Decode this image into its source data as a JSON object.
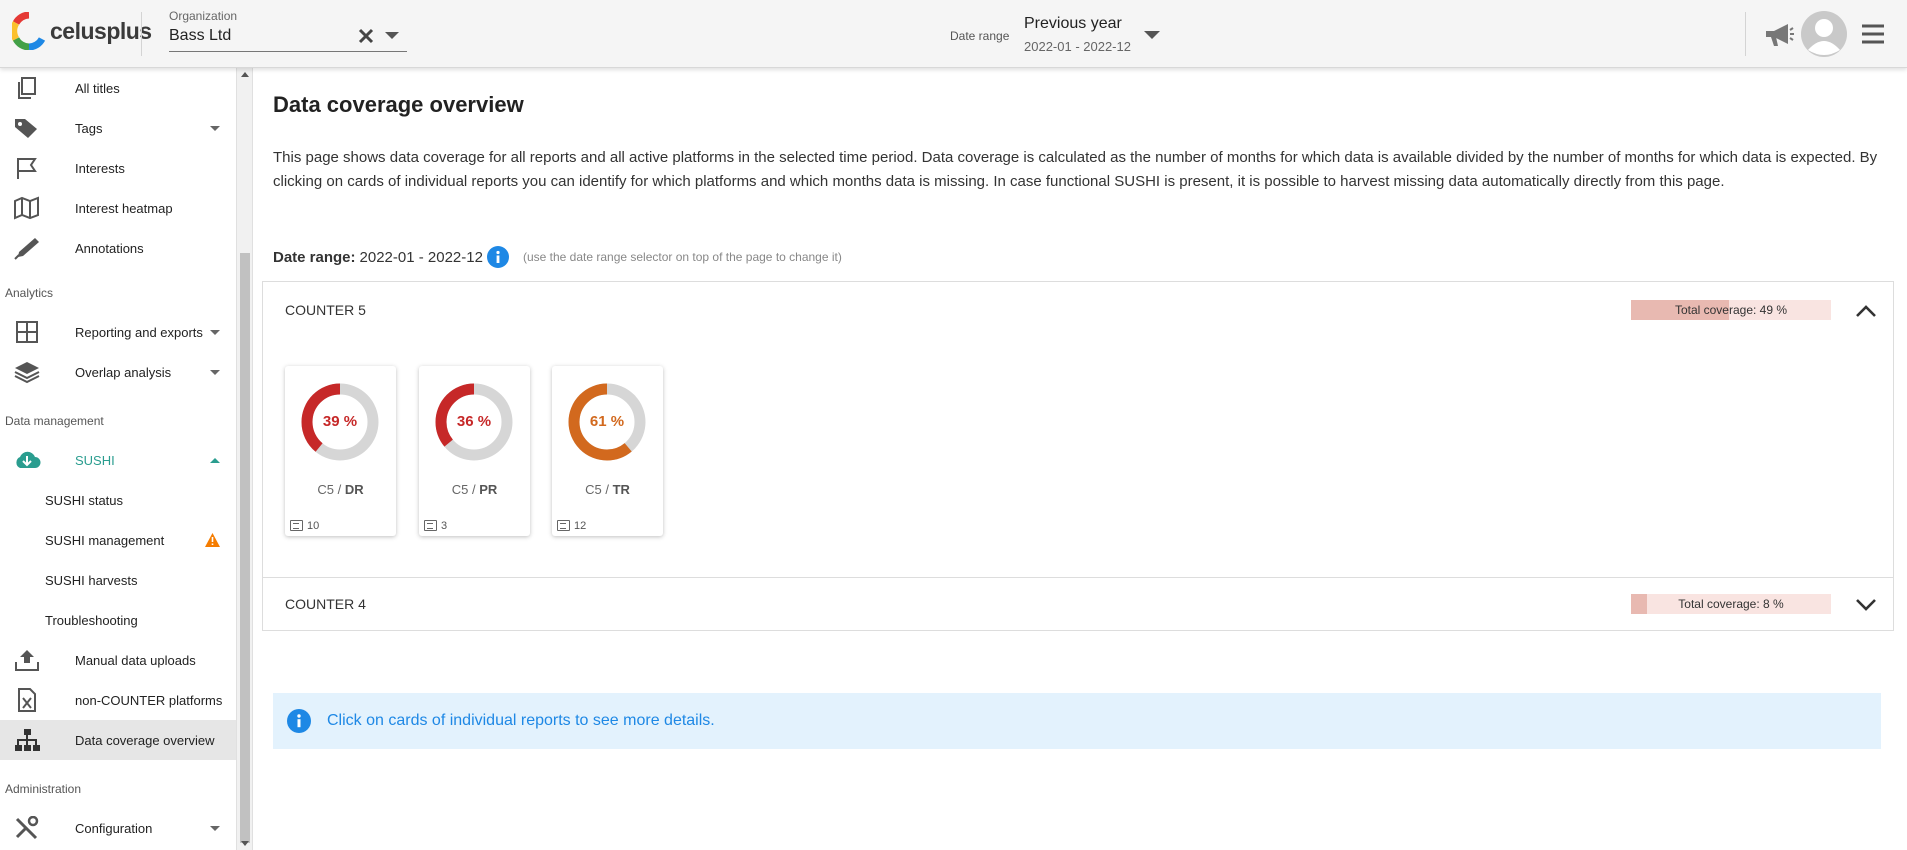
{
  "header": {
    "logo_text": "celusplus",
    "org_label": "Organization",
    "org_value": "Bass Ltd",
    "date_range_label": "Date range",
    "date_range_value": "Previous year",
    "date_range_sub": "2022-01 - 2022-12"
  },
  "sidebar": {
    "items_top": [
      {
        "label": "All titles"
      },
      {
        "label": "Tags"
      },
      {
        "label": "Interests"
      },
      {
        "label": "Interest heatmap"
      },
      {
        "label": "Annotations"
      }
    ],
    "section_analytics": "Analytics",
    "items_analytics": [
      {
        "label": "Reporting and exports"
      },
      {
        "label": "Overlap analysis"
      }
    ],
    "section_data_management": "Data management",
    "sushi": "SUSHI",
    "items_sushi": [
      {
        "label": "SUSHI status"
      },
      {
        "label": "SUSHI management"
      },
      {
        "label": "SUSHI harvests"
      },
      {
        "label": "Troubleshooting"
      }
    ],
    "items_data": [
      {
        "label": "Manual data uploads"
      },
      {
        "label": "non-COUNTER platforms"
      },
      {
        "label": "Data coverage overview"
      }
    ],
    "section_administration": "Administration",
    "items_admin": [
      {
        "label": "Configuration"
      }
    ]
  },
  "main": {
    "title": "Data coverage overview",
    "description": "This page shows data coverage for all reports and all active platforms in the selected time period. Data coverage is calculated as the number of months for which data is available divided by the number of months for which data is expected. By clicking on cards of individual reports you can identify for which platforms and which months data is missing. In case functional SUSHI is present, it is possible to harvest missing data automatically directly from this page.",
    "date_range_label": "Date range:",
    "date_range_value": "2022-01 - 2022-12",
    "date_range_hint": "(use the date range selector on top of the page to change it)",
    "panels": [
      {
        "title": "COUNTER 5",
        "coverage_text": "Total coverage: 49 %",
        "coverage": 0.49,
        "cards": [
          {
            "pct_text": "39 %",
            "pct": 0.39,
            "color": "#c62828",
            "prefix": "C5 / ",
            "code": "DR",
            "count": "10"
          },
          {
            "pct_text": "36 %",
            "pct": 0.36,
            "color": "#c62828",
            "prefix": "C5 / ",
            "code": "PR",
            "count": "3"
          },
          {
            "pct_text": "61 %",
            "pct": 0.61,
            "color": "#d2691e",
            "prefix": "C5 / ",
            "code": "TR",
            "count": "12"
          }
        ]
      },
      {
        "title": "COUNTER 4",
        "coverage_text": "Total coverage: 8 %",
        "coverage": 0.08
      }
    ],
    "alert_text": "Click on cards of individual reports to see more details."
  }
}
